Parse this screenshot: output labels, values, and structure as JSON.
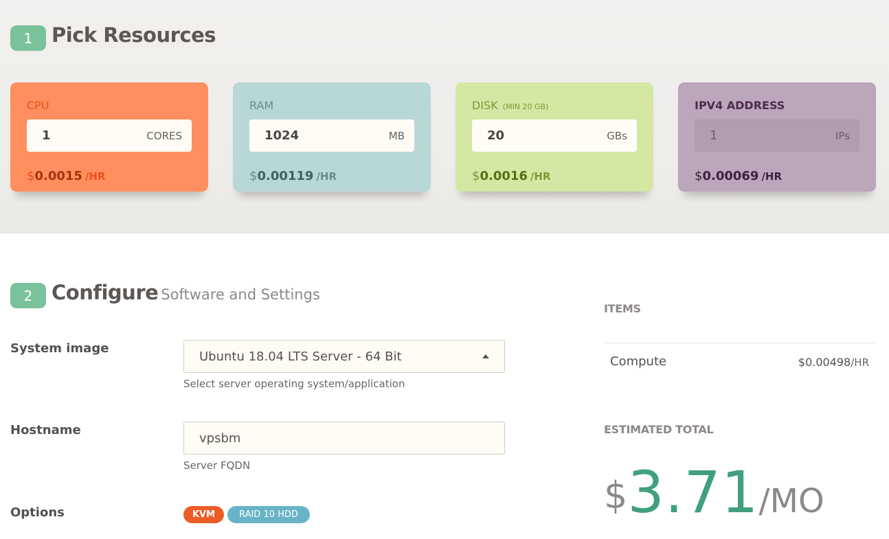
{
  "step1": {
    "number": "1",
    "title": "Pick Resources",
    "cards": [
      {
        "label": "CPU",
        "note": "",
        "value": "1",
        "unit": "CORES",
        "dollar": "$",
        "price": "0.0015",
        "per": "/HR"
      },
      {
        "label": "RAM",
        "note": "",
        "value": "1024",
        "unit": "MB",
        "dollar": "$",
        "price": "0.00119",
        "per": "/HR"
      },
      {
        "label": "DISK",
        "note": "(MIN 20 GB)",
        "value": "20",
        "unit": "GBs",
        "dollar": "$",
        "price": "0.0016",
        "per": "/HR"
      },
      {
        "label": "IPV4 ADDRESS",
        "note": "",
        "value": "1",
        "unit": "IPs",
        "dollar": "$",
        "price": "0.00069",
        "per": "/HR"
      }
    ]
  },
  "step2": {
    "number": "2",
    "title": "Configure",
    "subtitle": "Software and Settings",
    "system_image": {
      "label": "System image",
      "value": "Ubuntu 18.04 LTS Server - 64 Bit",
      "help": "Select server operating system/application"
    },
    "hostname": {
      "label": "Hostname",
      "value": "vpsbm",
      "help": "Server FQDN"
    },
    "options": {
      "label": "Options",
      "tags": [
        "KVM",
        "RAID 10 HDD"
      ]
    }
  },
  "summary": {
    "items_heading": "ITEMS",
    "item_name": "Compute",
    "item_price": "$0.00498",
    "item_per": "/HR",
    "total_heading": "ESTIMATED TOTAL",
    "total_dollar": "$",
    "total_amount": "3.71",
    "total_per": "/MO"
  },
  "colors": {
    "accent_green": "#7ac29a",
    "total_green": "#41a07c",
    "cpu": "#ff8f5e",
    "ram": "#b8d8d7",
    "disk": "#d4e7a3",
    "ip": "#bba6bb",
    "tag_kvm": "#eb5e28",
    "tag_raid": "#68b3c8"
  }
}
